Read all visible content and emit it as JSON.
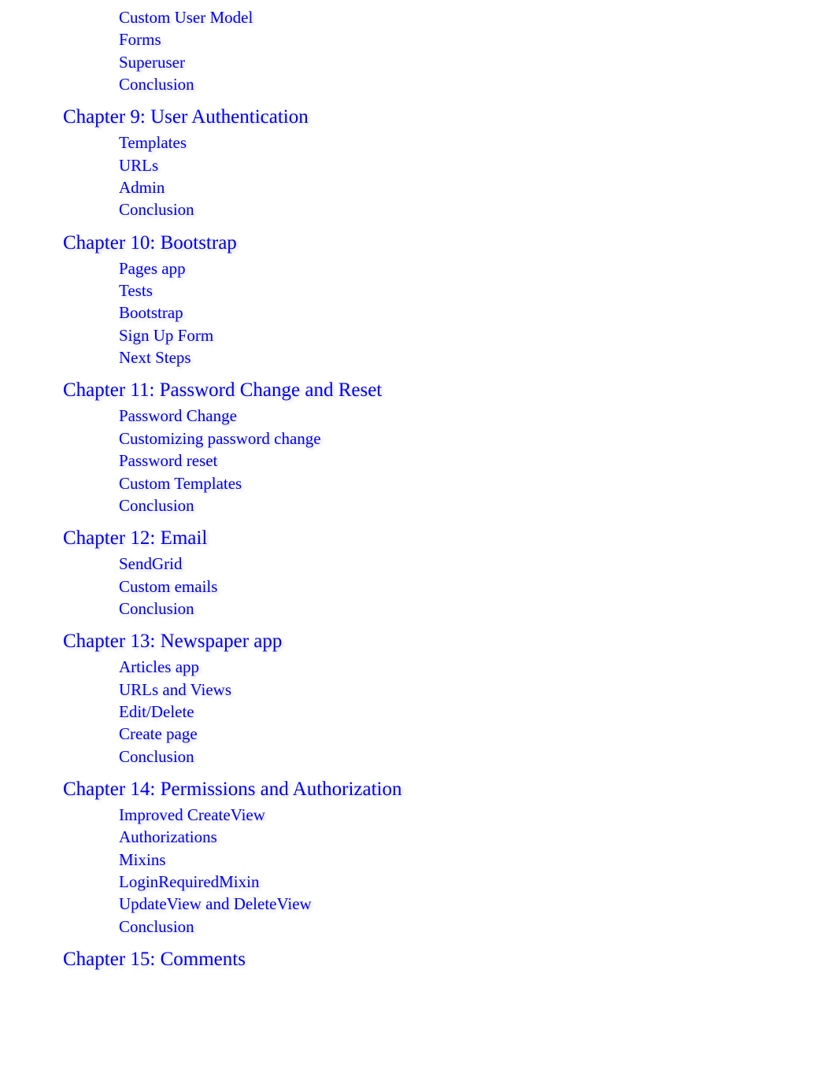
{
  "leading_subsections": [
    "Custom User Model",
    "Forms",
    "Superuser",
    "Conclusion"
  ],
  "chapters": [
    {
      "title": "Chapter 9: User Authentication",
      "subsections": [
        "Templates",
        "URLs",
        "Admin",
        "Conclusion"
      ]
    },
    {
      "title": "Chapter 10: Bootstrap",
      "subsections": [
        "Pages app",
        "Tests",
        "Bootstrap",
        "Sign Up Form",
        "Next Steps"
      ]
    },
    {
      "title": "Chapter 11: Password Change and Reset",
      "subsections": [
        "Password Change",
        "Customizing password change",
        "Password reset",
        "Custom Templates",
        "Conclusion"
      ]
    },
    {
      "title": "Chapter 12: Email",
      "subsections": [
        "SendGrid",
        "Custom emails",
        "Conclusion"
      ]
    },
    {
      "title": "Chapter 13: Newspaper app",
      "subsections": [
        "Articles app",
        "URLs and Views",
        "Edit/Delete",
        "Create page",
        "Conclusion"
      ]
    },
    {
      "title": "Chapter 14: Permissions and Authorization",
      "subsections": [
        "Improved CreateView",
        "Authorizations",
        "Mixins",
        "LoginRequiredMixin",
        "UpdateView and DeleteView",
        "Conclusion"
      ]
    },
    {
      "title": "Chapter 15: Comments",
      "subsections": []
    }
  ]
}
